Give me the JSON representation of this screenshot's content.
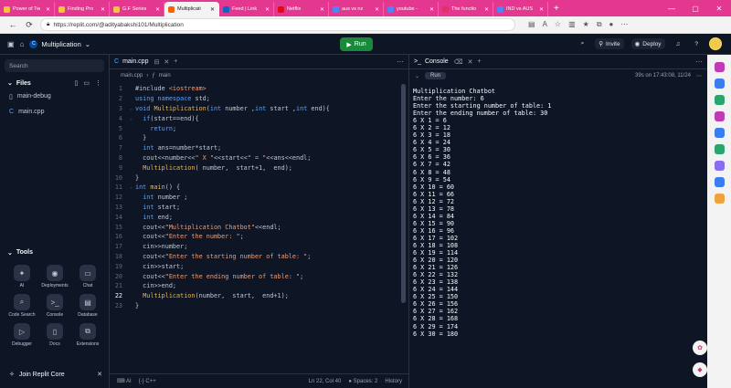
{
  "browser": {
    "tabs": [
      {
        "title": "Power of Tw",
        "color": "#f6c344"
      },
      {
        "title": "Finding Pro",
        "color": "#f6c344"
      },
      {
        "title": "G.F Series",
        "color": "#f6c344"
      },
      {
        "title": "Multiplicati",
        "color": "#f26207",
        "active": true
      },
      {
        "title": "Feed | Link",
        "color": "#0a66c2"
      },
      {
        "title": "Netflix",
        "color": "#e50914"
      },
      {
        "title": "aus vs nz",
        "color": "#4f86f7"
      },
      {
        "title": "youtube -",
        "color": "#4f86f7"
      },
      {
        "title": "The functio",
        "color": "#e1306c"
      },
      {
        "title": "IND vs AUS",
        "color": "#4f86f7"
      }
    ],
    "url": "https://replit.com/@adityabakshi101/Multiplication"
  },
  "header": {
    "project_name": "Multiplication",
    "run_label": "Run",
    "invite_label": "Invite",
    "deploy_label": "Deploy"
  },
  "sidebar": {
    "search_placeholder": "Search",
    "files_title": "Files",
    "files": [
      "main-debug",
      "main.cpp"
    ],
    "tools_title": "Tools",
    "tools": [
      {
        "label": "AI",
        "icon": "ai-icon",
        "glyph": "✦"
      },
      {
        "label": "Deployments",
        "icon": "deployments-icon",
        "glyph": "◉"
      },
      {
        "label": "Chat",
        "icon": "chat-icon",
        "glyph": "▭"
      },
      {
        "label": "Code Search",
        "icon": "code-search-icon",
        "glyph": "⌕"
      },
      {
        "label": "Console",
        "icon": "console-icon",
        "glyph": ">_"
      },
      {
        "label": "Database",
        "icon": "database-icon",
        "glyph": "▤"
      },
      {
        "label": "Debugger",
        "icon": "debugger-icon",
        "glyph": "▷"
      },
      {
        "label": "Docs",
        "icon": "docs-icon",
        "glyph": "▯"
      },
      {
        "label": "Extensions",
        "icon": "extensions-icon",
        "glyph": "⧉"
      }
    ],
    "join_core_label": "Join Replit Core"
  },
  "editor": {
    "tab_label": "main.cpp",
    "breadcrumb_file": "main.cpp",
    "breadcrumb_symbol": "main",
    "code_lines": [
      [
        [
          "pl",
          "#include "
        ],
        [
          "str",
          "<iostream>"
        ]
      ],
      [
        [
          "kw",
          "using namespace "
        ],
        [
          "pl",
          "std;"
        ]
      ],
      [
        [
          "kw",
          "void "
        ],
        [
          "fn",
          "Multiplication"
        ],
        [
          "pl",
          "("
        ],
        [
          "kw",
          "int "
        ],
        [
          "pl",
          "number ,"
        ],
        [
          "kw",
          "int "
        ],
        [
          "pl",
          "start ,"
        ],
        [
          "kw",
          "int "
        ],
        [
          "pl",
          "end){"
        ]
      ],
      [
        [
          "pl",
          "  "
        ],
        [
          "kw",
          "if"
        ],
        [
          "pl",
          "(start==end){"
        ]
      ],
      [
        [
          "pl",
          "    "
        ],
        [
          "kw",
          "return"
        ],
        [
          "pl",
          ";"
        ]
      ],
      [
        [
          "pl",
          "  }"
        ]
      ],
      [
        [
          "pl",
          "  "
        ],
        [
          "kw",
          "int "
        ],
        [
          "pl",
          "ans=number*start;"
        ]
      ],
      [
        [
          "pl",
          "  cout<<number<<"
        ],
        [
          "str",
          "\" X \""
        ],
        [
          "pl",
          "<<start<<"
        ],
        [
          "str",
          "\" = \""
        ],
        [
          "pl",
          "<<ans<<endl;"
        ]
      ],
      [
        [
          "pl",
          "  "
        ],
        [
          "fn",
          "Multiplication"
        ],
        [
          "pl",
          "( number,  start+"
        ],
        [
          "num",
          "1"
        ],
        [
          "pl",
          ",  end);"
        ]
      ],
      [
        [
          "pl",
          "}"
        ]
      ],
      [
        [
          "kw",
          "int "
        ],
        [
          "fn",
          "main"
        ],
        [
          "pl",
          "() {"
        ]
      ],
      [
        [
          "pl",
          "  "
        ],
        [
          "kw",
          "int "
        ],
        [
          "pl",
          "number ;"
        ]
      ],
      [
        [
          "pl",
          "  "
        ],
        [
          "kw",
          "int "
        ],
        [
          "pl",
          "start;"
        ]
      ],
      [
        [
          "pl",
          "  "
        ],
        [
          "kw",
          "int "
        ],
        [
          "pl",
          "end;"
        ]
      ],
      [
        [
          "pl",
          "  cout<<"
        ],
        [
          "str",
          "\"Multiplication Chatbot\""
        ],
        [
          "pl",
          "<<endl;"
        ]
      ],
      [
        [
          "pl",
          "  cout<<"
        ],
        [
          "str",
          "\"Enter the number: \""
        ],
        [
          "pl",
          ";"
        ]
      ],
      [
        [
          "pl",
          "  cin>>number;"
        ]
      ],
      [
        [
          "pl",
          "  cout<<"
        ],
        [
          "str",
          "\"Enter the starting number of table: \""
        ],
        [
          "pl",
          ";"
        ]
      ],
      [
        [
          "pl",
          "  cin>>start;"
        ]
      ],
      [
        [
          "pl",
          "  cout<<"
        ],
        [
          "str",
          "\"Enter the ending number of table: \""
        ],
        [
          "pl",
          ";"
        ]
      ],
      [
        [
          "pl",
          "  cin>>end;"
        ]
      ],
      [
        [
          "pl",
          "  "
        ],
        [
          "fn",
          "Multiplication"
        ],
        [
          "pl",
          "(number,  start,  end+"
        ],
        [
          "num",
          "1"
        ],
        [
          "pl",
          ");"
        ]
      ],
      [
        [
          "pl",
          "}"
        ]
      ]
    ],
    "fold_lines": [
      3,
      4,
      11
    ],
    "current_line": 22,
    "status_ai": "AI",
    "status_lang": "C++",
    "status_position": "Ln 22, Col 40",
    "status_spaces": "Spaces: 2",
    "status_history": "History"
  },
  "console": {
    "tab_label": "Console",
    "run_chip": "Run",
    "meta": "39s on 17:43:08, 11/24",
    "output": [
      "Multiplication Chatbot",
      "Enter the number: 6",
      "Enter the starting number of table: 1",
      "Enter the ending number of table: 30",
      "6 X 1 = 6",
      "6 X 2 = 12",
      "6 X 3 = 18",
      "6 X 4 = 24",
      "6 X 5 = 30",
      "6 X 6 = 36",
      "6 X 7 = 42",
      "6 X 8 = 48",
      "6 X 9 = 54",
      "6 X 10 = 60",
      "6 X 11 = 66",
      "6 X 12 = 72",
      "6 X 13 = 78",
      "6 X 14 = 84",
      "6 X 15 = 90",
      "6 X 16 = 96",
      "6 X 17 = 102",
      "6 X 18 = 108",
      "6 X 19 = 114",
      "6 X 20 = 120",
      "6 X 21 = 126",
      "6 X 22 = 132",
      "6 X 23 = 138",
      "6 X 24 = 144",
      "6 X 25 = 150",
      "6 X 26 = 156",
      "6 X 27 = 162",
      "6 X 28 = 168",
      "6 X 29 = 174",
      "6 X 30 = 180"
    ]
  },
  "edge_sidebar_colors": [
    "#c03ab6",
    "#3b7cf0",
    "#2aa56b",
    "#c03ab6",
    "#3b7cf0",
    "#2aa56b",
    "#8a6cf0",
    "#3b7cf0",
    "#f0a23b"
  ]
}
